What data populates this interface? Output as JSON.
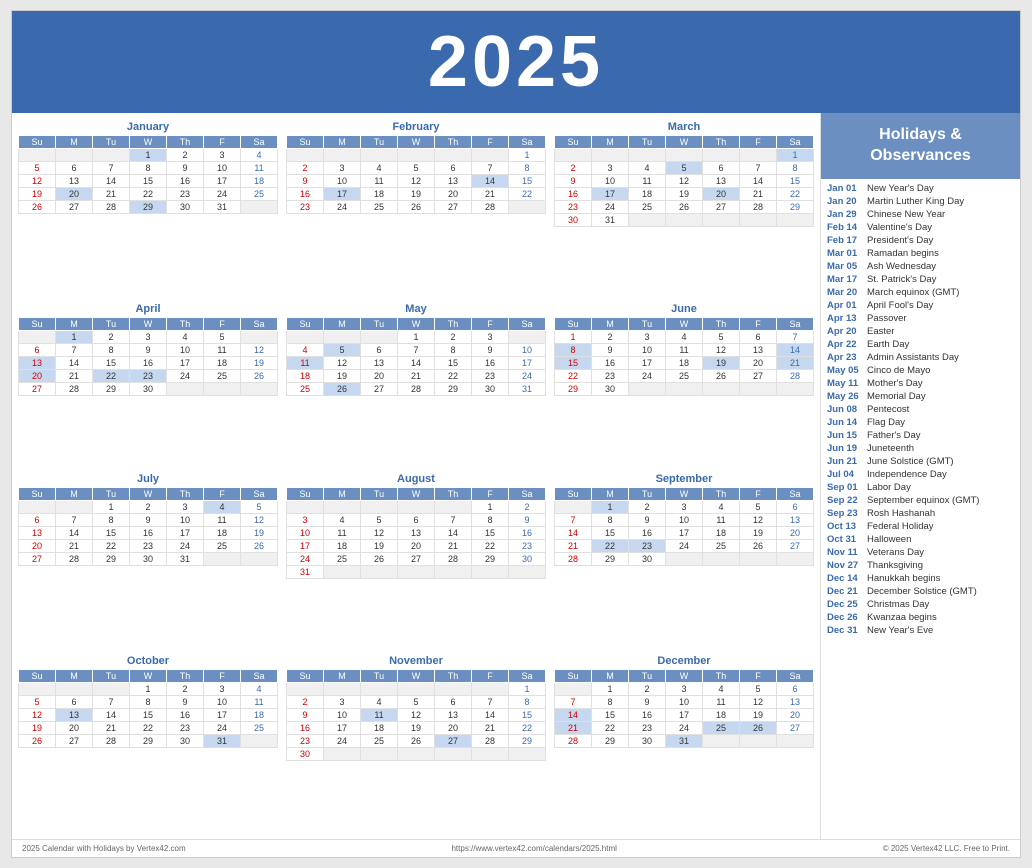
{
  "header": {
    "year": "2025"
  },
  "sidebar": {
    "title": "Holidays &\nObservances",
    "holidays": [
      {
        "date": "Jan 01",
        "name": "New Year's Day"
      },
      {
        "date": "Jan 20",
        "name": "Martin Luther King Day"
      },
      {
        "date": "Jan 29",
        "name": "Chinese New Year"
      },
      {
        "date": "Feb 14",
        "name": "Valentine's Day"
      },
      {
        "date": "Feb 17",
        "name": "President's Day"
      },
      {
        "date": "Mar 01",
        "name": "Ramadan begins"
      },
      {
        "date": "Mar 05",
        "name": "Ash Wednesday"
      },
      {
        "date": "Mar 17",
        "name": "St. Patrick's Day"
      },
      {
        "date": "Mar 20",
        "name": "March equinox (GMT)"
      },
      {
        "date": "Apr 01",
        "name": "April Fool's Day"
      },
      {
        "date": "Apr 13",
        "name": "Passover"
      },
      {
        "date": "Apr 20",
        "name": "Easter"
      },
      {
        "date": "Apr 22",
        "name": "Earth Day"
      },
      {
        "date": "Apr 23",
        "name": "Admin Assistants Day"
      },
      {
        "date": "May 05",
        "name": "Cinco de Mayo"
      },
      {
        "date": "May 11",
        "name": "Mother's Day"
      },
      {
        "date": "May 26",
        "name": "Memorial Day"
      },
      {
        "date": "Jun 08",
        "name": "Pentecost"
      },
      {
        "date": "Jun 14",
        "name": "Flag Day"
      },
      {
        "date": "Jun 15",
        "name": "Father's Day"
      },
      {
        "date": "Jun 19",
        "name": "Juneteenth"
      },
      {
        "date": "Jun 21",
        "name": "June Solstice (GMT)"
      },
      {
        "date": "Jul 04",
        "name": "Independence Day"
      },
      {
        "date": "Sep 01",
        "name": "Labor Day"
      },
      {
        "date": "Sep 22",
        "name": "September equinox (GMT)"
      },
      {
        "date": "Sep 23",
        "name": "Rosh Hashanah"
      },
      {
        "date": "Oct 13",
        "name": "Federal Holiday"
      },
      {
        "date": "Oct 31",
        "name": "Halloween"
      },
      {
        "date": "Nov 11",
        "name": "Veterans Day"
      },
      {
        "date": "Nov 27",
        "name": "Thanksgiving"
      },
      {
        "date": "Dec 14",
        "name": "Hanukkah begins"
      },
      {
        "date": "Dec 21",
        "name": "December Solstice (GMT)"
      },
      {
        "date": "Dec 25",
        "name": "Christmas Day"
      },
      {
        "date": "Dec 26",
        "name": "Kwanzaa begins"
      },
      {
        "date": "Dec 31",
        "name": "New Year's Eve"
      }
    ]
  },
  "footer": {
    "left": "2025 Calendar with Holidays by Vertex42.com",
    "center": "https://www.vertex42.com/calendars/2025.html",
    "right": "© 2025 Vertex42 LLC. Free to Print."
  },
  "months": [
    {
      "name": "January",
      "days": [
        [
          "",
          "",
          "",
          "1h",
          "2",
          "3",
          "4"
        ],
        [
          "5",
          "6",
          "7",
          "8",
          "9",
          "10",
          "11"
        ],
        [
          "12",
          "13",
          "14",
          "15",
          "16",
          "17",
          "18"
        ],
        [
          "19",
          "20h",
          "21",
          "22",
          "23",
          "24",
          "25"
        ],
        [
          "26",
          "27",
          "28",
          "29h",
          "30",
          "31",
          ""
        ]
      ]
    },
    {
      "name": "February",
      "days": [
        [
          "",
          "",
          "",
          "",
          "",
          "",
          "1"
        ],
        [
          "2",
          "3",
          "4",
          "5",
          "6",
          "7",
          "8"
        ],
        [
          "9",
          "10",
          "11",
          "12",
          "13",
          "14h",
          "15"
        ],
        [
          "16",
          "17h",
          "18",
          "19",
          "20",
          "21",
          "22"
        ],
        [
          "23",
          "24",
          "25",
          "26",
          "27",
          "28",
          ""
        ]
      ]
    },
    {
      "name": "March",
      "days": [
        [
          "",
          "",
          "",
          "",
          "",
          "",
          "1h"
        ],
        [
          "2",
          "3",
          "4",
          "5h",
          "6",
          "7",
          "8"
        ],
        [
          "9",
          "10",
          "11",
          "12",
          "13",
          "14",
          "15"
        ],
        [
          "16",
          "17h",
          "18",
          "19",
          "20h",
          "21",
          "22"
        ],
        [
          "23",
          "24",
          "25",
          "26",
          "27",
          "28",
          "29"
        ],
        [
          "30",
          "31",
          "",
          "",
          "",
          "",
          ""
        ]
      ]
    },
    {
      "name": "April",
      "days": [
        [
          "",
          "1h",
          "2",
          "3",
          "4",
          "5",
          ""
        ],
        [
          "6",
          "7",
          "8",
          "9",
          "10",
          "11",
          "12"
        ],
        [
          "13h",
          "14",
          "15",
          "16",
          "17",
          "18",
          "19"
        ],
        [
          "20h",
          "21",
          "22h",
          "23h",
          "24",
          "25",
          "26"
        ],
        [
          "27",
          "28",
          "29",
          "30",
          "",
          "",
          ""
        ]
      ]
    },
    {
      "name": "May",
      "days": [
        [
          "",
          "",
          "",
          "1",
          "2",
          "3",
          ""
        ],
        [
          "4",
          "5h",
          "6",
          "7",
          "8",
          "9",
          "10"
        ],
        [
          "11h",
          "12",
          "13",
          "14",
          "15",
          "16",
          "17"
        ],
        [
          "18",
          "19",
          "20",
          "21",
          "22",
          "23",
          "24"
        ],
        [
          "25",
          "26h",
          "27",
          "28",
          "29",
          "30",
          "31"
        ]
      ]
    },
    {
      "name": "June",
      "days": [
        [
          "1",
          "2",
          "3",
          "4",
          "5",
          "6",
          "7"
        ],
        [
          "8h",
          "9",
          "10",
          "11",
          "12",
          "13",
          "14h"
        ],
        [
          "15h",
          "16",
          "17",
          "18",
          "19h",
          "20",
          "21h"
        ],
        [
          "22",
          "23",
          "24",
          "25",
          "26",
          "27",
          "28"
        ],
        [
          "29",
          "30",
          "",
          "",
          "",
          "",
          ""
        ]
      ]
    },
    {
      "name": "July",
      "days": [
        [
          "",
          "",
          "1",
          "2",
          "3",
          "4h",
          "5"
        ],
        [
          "6",
          "7",
          "8",
          "9",
          "10",
          "11",
          "12"
        ],
        [
          "13",
          "14",
          "15",
          "16",
          "17",
          "18",
          "19"
        ],
        [
          "20",
          "21",
          "22",
          "23",
          "24",
          "25",
          "26"
        ],
        [
          "27",
          "28",
          "29",
          "30",
          "31",
          "",
          ""
        ]
      ]
    },
    {
      "name": "August",
      "days": [
        [
          "",
          "",
          "",
          "",
          "",
          "1",
          "2"
        ],
        [
          "3",
          "4",
          "5",
          "6",
          "7",
          "8",
          "9"
        ],
        [
          "10",
          "11",
          "12",
          "13",
          "14",
          "15",
          "16"
        ],
        [
          "17",
          "18",
          "19",
          "20",
          "21",
          "22",
          "23"
        ],
        [
          "24",
          "25",
          "26",
          "27",
          "28",
          "29",
          "30"
        ],
        [
          "31",
          "",
          "",
          "",
          "",
          "",
          ""
        ]
      ]
    },
    {
      "name": "September",
      "days": [
        [
          "",
          "1h",
          "2",
          "3",
          "4",
          "5",
          "6"
        ],
        [
          "7",
          "8",
          "9",
          "10",
          "11",
          "12",
          "13"
        ],
        [
          "14",
          "15",
          "16",
          "17",
          "18",
          "19",
          "20"
        ],
        [
          "21",
          "22h",
          "23h",
          "24",
          "25",
          "26",
          "27"
        ],
        [
          "28",
          "29",
          "30",
          "",
          "",
          "",
          ""
        ]
      ]
    },
    {
      "name": "October",
      "days": [
        [
          "",
          "",
          "",
          "1",
          "2",
          "3",
          "4"
        ],
        [
          "5",
          "6",
          "7",
          "8",
          "9",
          "10",
          "11"
        ],
        [
          "12",
          "13h",
          "14",
          "15",
          "16",
          "17",
          "18"
        ],
        [
          "19",
          "20",
          "21",
          "22",
          "23",
          "24",
          "25"
        ],
        [
          "26",
          "27",
          "28",
          "29",
          "30",
          "31h",
          ""
        ]
      ]
    },
    {
      "name": "November",
      "days": [
        [
          "",
          "",
          "",
          "",
          "",
          "",
          "1"
        ],
        [
          "2",
          "3",
          "4",
          "5",
          "6",
          "7",
          "8"
        ],
        [
          "9",
          "10",
          "11h",
          "12",
          "13",
          "14",
          "15"
        ],
        [
          "16",
          "17",
          "18",
          "19",
          "20",
          "21",
          "22"
        ],
        [
          "23",
          "24",
          "25",
          "26",
          "27h",
          "28",
          "29"
        ],
        [
          "30",
          "",
          "",
          "",
          "",
          "",
          ""
        ]
      ]
    },
    {
      "name": "December",
      "days": [
        [
          "",
          "1",
          "2",
          "3",
          "4",
          "5",
          "6"
        ],
        [
          "7",
          "8",
          "9",
          "10",
          "11",
          "12",
          "13"
        ],
        [
          "14h",
          "15",
          "16",
          "17",
          "18",
          "19",
          "20"
        ],
        [
          "21h",
          "22",
          "23",
          "24",
          "25h",
          "26h",
          "27"
        ],
        [
          "28",
          "29",
          "30",
          "31h",
          "",
          "",
          ""
        ]
      ]
    }
  ]
}
